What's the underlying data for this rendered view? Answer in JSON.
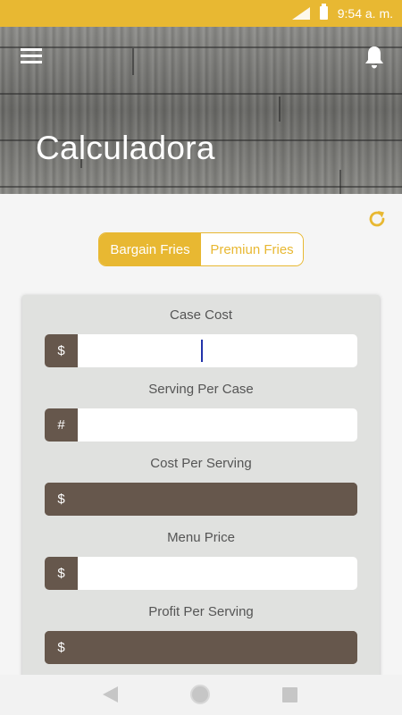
{
  "status_bar": {
    "time": "9:54 a. m.",
    "color": "#e8b832"
  },
  "header": {
    "title": "Calculadora",
    "menu_icon": "hamburger-menu-icon",
    "notification_icon": "bell-icon"
  },
  "toolbar": {
    "refresh_icon": "refresh-icon"
  },
  "tabs": [
    {
      "label": "Bargain Fries",
      "active": true
    },
    {
      "label": "Premiun Fries",
      "active": false
    }
  ],
  "calculator": {
    "fields": [
      {
        "label": "Case Cost",
        "prefix": "$",
        "value": "",
        "editable": true,
        "focused": true
      },
      {
        "label": "Serving Per Case",
        "prefix": "#",
        "value": "",
        "editable": true
      },
      {
        "label": "Cost Per Serving",
        "prefix": "$",
        "value": "",
        "editable": false
      },
      {
        "label": "Menu Price",
        "prefix": "$",
        "value": "",
        "editable": true
      },
      {
        "label": "Profit Per Serving",
        "prefix": "$",
        "value": "",
        "editable": false
      }
    ]
  },
  "colors": {
    "accent": "#e8b832",
    "prefix_brown": "#66574c",
    "card_bg": "#e0e1df"
  },
  "nav_bar": {
    "back_icon": "back-triangle-icon",
    "home_icon": "home-circle-icon",
    "recent_icon": "recent-apps-square-icon"
  }
}
